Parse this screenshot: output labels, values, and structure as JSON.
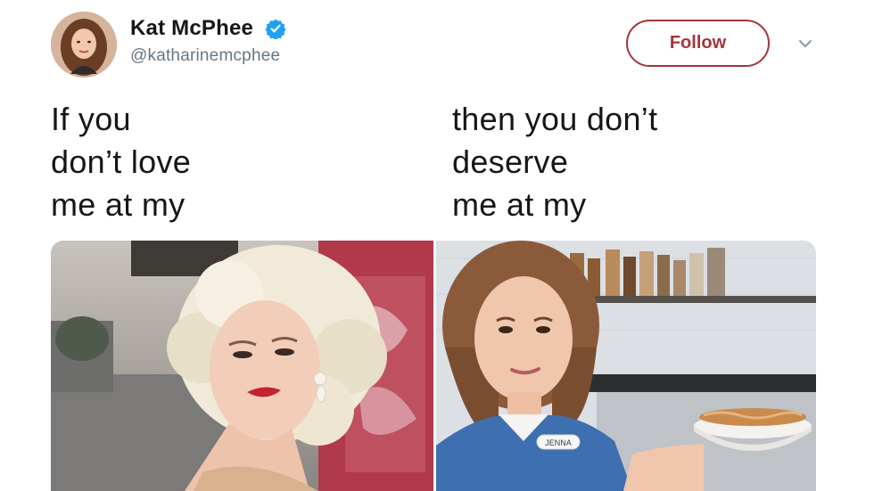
{
  "tweet": {
    "author": {
      "display_name": "Kat McPhee",
      "handle": "@katharinemcphee",
      "verified": true,
      "avatar_icon": "avatar-photo"
    },
    "follow_button": {
      "label": "Follow"
    },
    "menu_icon": "chevron-down-icon",
    "caption_left": [
      "If you",
      "don’t love",
      "me at my"
    ],
    "caption_right": [
      "then you don’t",
      "deserve",
      "me at my"
    ],
    "media": [
      {
        "icon": "photo-blonde-woman-red-lips"
      },
      {
        "icon": "photo-waitress-holding-pie",
        "name_tag": "JENNA"
      }
    ]
  },
  "colors": {
    "follow_accent": "#a4343a",
    "verified_blue": "#1da1f2",
    "handle_gray": "#657786",
    "text": "#14171a"
  }
}
